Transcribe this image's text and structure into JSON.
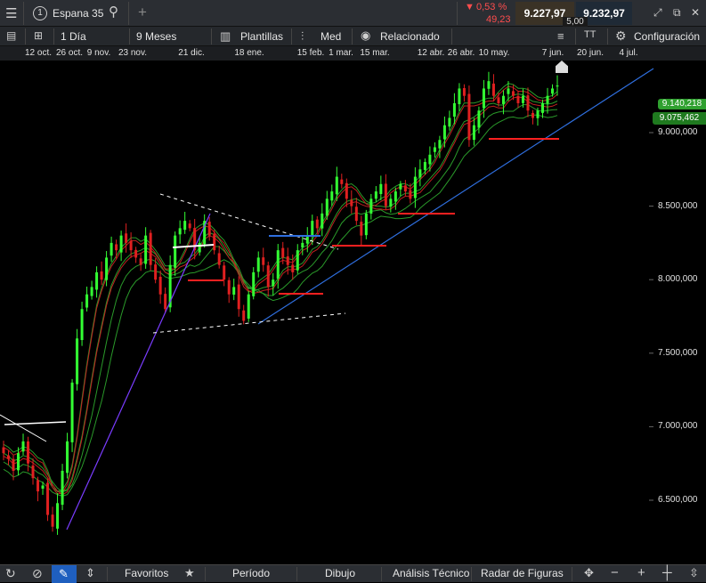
{
  "header": {
    "menu_icon": "hamburger-icon",
    "instrument_number": "1",
    "instrument_name": "Espana 35",
    "add_symbol": "+",
    "change_pct": "0,53 %",
    "change_abs": "49,23",
    "bid": "9.227,97",
    "ask": "9.232,97",
    "spread": "5,00",
    "colors": {
      "down": "#ff4d4d",
      "bid_bg": "#3a3226",
      "ask_bg": "#1f2a36"
    }
  },
  "toolbar": {
    "interval": "1 Día",
    "range": "9 Meses",
    "templates": "Plantillas",
    "chart_type": "Med",
    "related": "Relacionado",
    "config": "Configuración"
  },
  "date_axis": [
    "12 oct.",
    "26 oct.",
    "9 nov.",
    "23 nov.",
    "21 dic.",
    "18 ene.",
    "15 feb.",
    "1 mar.",
    "15 mar.",
    "12 abr.",
    "26 abr.",
    "10 may.",
    "7 jun.",
    "20 jun.",
    "4 jul."
  ],
  "bottom_bar": {
    "favorites": "Favoritos",
    "period": "Período",
    "drawing": "Dibujo",
    "technical": "Análisis Técnico",
    "patterns": "Radar de Figuras"
  },
  "chart_data": {
    "type": "candlestick",
    "price_axis_ticks": [
      "6.500,000",
      "7.000,000",
      "7.500,000",
      "8.000,000",
      "8.500,000",
      "9.000,000"
    ],
    "ylim": [
      6250,
      9650
    ],
    "current_label_1": "9.140,218",
    "current_label_2": "9.075,462",
    "colors": {
      "up": "#33ff33",
      "down": "#e02020",
      "ma_green": "#2a9a2a",
      "ma_red": "#c02020",
      "trend_blue": "#2f6fe0",
      "trend_purple": "#7a3cff"
    },
    "closes": [
      6820,
      6780,
      6700,
      6820,
      6900,
      6750,
      6650,
      6560,
      6600,
      6400,
      6320,
      6480,
      6700,
      6900,
      7300,
      7600,
      7800,
      7900,
      7950,
      8050,
      8000,
      8150,
      8250,
      8200,
      8300,
      8250,
      8200,
      8150,
      8100,
      8300,
      8100,
      8000,
      7900,
      7800,
      8100,
      8300,
      8350,
      8400,
      8350,
      8200,
      8250,
      8400,
      8300,
      8200,
      8100,
      8000,
      7900,
      7950,
      7800,
      7720,
      7900,
      8050,
      8150,
      8100,
      7950,
      8000,
      8200,
      8150,
      8100,
      8050,
      8200,
      8250,
      8300,
      8400,
      8350,
      8450,
      8550,
      8600,
      8700,
      8650,
      8550,
      8500,
      8400,
      8300,
      8450,
      8550,
      8600,
      8650,
      8500,
      8550,
      8600,
      8650,
      8600,
      8550,
      8700,
      8750,
      8800,
      8850,
      8900,
      8950,
      9050,
      9100,
      9200,
      9300,
      9250,
      8950,
      9050,
      9150,
      9300,
      9350,
      9250,
      9200,
      9250,
      9300,
      9250,
      9200,
      9250,
      9150,
      9100,
      9150,
      9200,
      9250,
      9300,
      9320
    ]
  }
}
